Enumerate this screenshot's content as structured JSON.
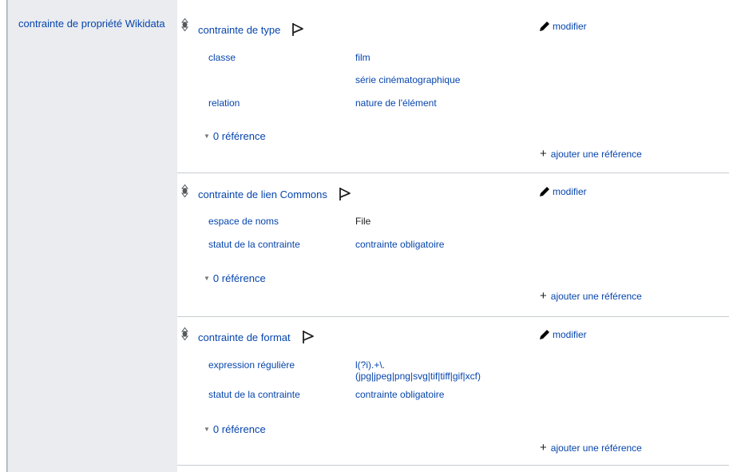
{
  "property": {
    "label": "contrainte de propriété Wikidata"
  },
  "statements": [
    {
      "value": "contrainte de type",
      "edit_label": "modifier",
      "qualifiers": [
        {
          "property": "classe",
          "values": [
            "film",
            "série cinématographique"
          ]
        },
        {
          "property": "relation",
          "values": [
            "nature de l'élément"
          ]
        }
      ],
      "references": "0 référence",
      "add_reference": "ajouter une référence"
    },
    {
      "value": "contrainte de lien Commons",
      "edit_label": "modifier",
      "qualifiers": [
        {
          "property": "espace de noms",
          "values": [
            "File"
          ]
        },
        {
          "property": "statut de la contrainte",
          "values": [
            "contrainte obligatoire"
          ]
        }
      ],
      "references": "0 référence",
      "add_reference": "ajouter une référence"
    },
    {
      "value": "contrainte de format",
      "edit_label": "modifier",
      "qualifiers": [
        {
          "property": "expression régulière",
          "values": [
            "l(?i).+\\.",
            "(jpg|jpeg|png|svg|tif|tiff|gif|xcf)"
          ]
        },
        {
          "property": "statut de la contrainte",
          "values": [
            "contrainte obligatoire"
          ]
        }
      ],
      "references": "0 référence",
      "add_reference": "ajouter une référence"
    }
  ]
}
